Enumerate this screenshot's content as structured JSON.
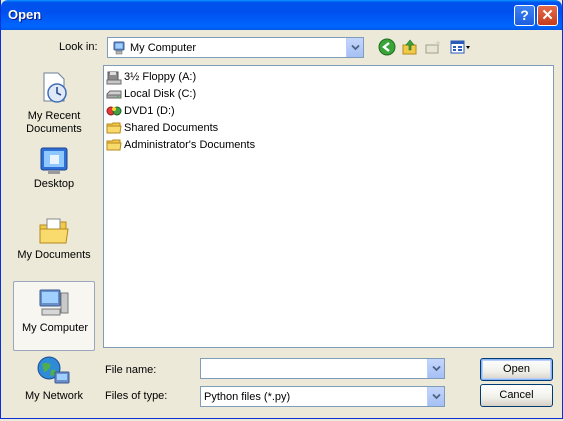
{
  "window": {
    "title": "Open",
    "help_glyph": "?",
    "close_glyph": "✕"
  },
  "lookin": {
    "label": "Look in:",
    "value": "My Computer",
    "icon": "my-computer-icon"
  },
  "toolbar": {
    "icons": [
      "back-icon",
      "up-folder-icon",
      "new-folder-icon",
      "views-menu-icon"
    ]
  },
  "places": [
    {
      "label": "My Recent Documents",
      "icon": "recent-documents-icon"
    },
    {
      "label": "Desktop",
      "icon": "desktop-icon"
    },
    {
      "label": "My Documents",
      "icon": "my-documents-icon"
    },
    {
      "label": "My Computer",
      "icon": "my-computer-icon",
      "selected": true
    },
    {
      "label": "My Network",
      "icon": "my-network-icon"
    }
  ],
  "files": [
    {
      "name": "3½ Floppy (A:)",
      "icon": "floppy-drive-icon"
    },
    {
      "name": "Local Disk (C:)",
      "icon": "hard-disk-icon"
    },
    {
      "name": "DVD1 (D:)",
      "icon": "dvd-drive-icon"
    },
    {
      "name": "Shared Documents",
      "icon": "folder-icon"
    },
    {
      "name": "Administrator's Documents",
      "icon": "folder-icon"
    }
  ],
  "filename": {
    "label": "File name:",
    "value": "",
    "placeholder": ""
  },
  "filetype": {
    "label": "Files of type:",
    "value": "Python files (*.py)"
  },
  "buttons": {
    "open": "Open",
    "cancel": "Cancel"
  },
  "colors": {
    "titlebar": "#0054e3",
    "dialog_bg": "#ece9d8",
    "field_border": "#7f9db9"
  }
}
